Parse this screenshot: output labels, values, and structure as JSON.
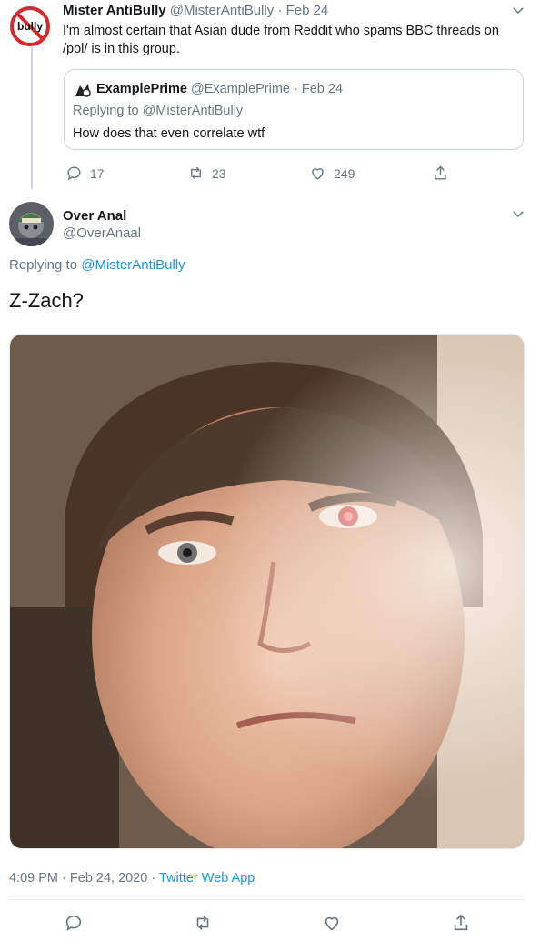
{
  "parent_tweet": {
    "avatar_text": "bully",
    "name": "Mister AntiBully",
    "handle": "@MisterAntiBully",
    "date": "Feb 24",
    "text": "I'm almost certain that Asian dude from Reddit who spams BBC threads on /pol/ is in this group.",
    "quoted": {
      "name": "ExamplePrime",
      "handle": "@ExamplePrime",
      "date": "Feb 24",
      "replying_label": "Replying to",
      "replying_to": "@MisterAntiBully",
      "text": "How does that even correlate wtf"
    },
    "actions": {
      "replies": "17",
      "retweets": "23",
      "likes": "249"
    }
  },
  "main_tweet": {
    "name": "Over Anal",
    "handle": "@OverAnaal",
    "replying_label": "Replying to",
    "replying_to": "@MisterAntiBully",
    "text": "Z-Zach?",
    "time": "4:09 PM",
    "date": "Feb 24, 2020",
    "source": "Twitter Web App"
  },
  "colors": {
    "link": "#1b95e0",
    "muted": "#657786",
    "border": "#ccd6dd",
    "brand_red": "#d4292c"
  },
  "icons": [
    "no-bully-icon",
    "chevron-down-icon",
    "reply-icon",
    "retweet-icon",
    "like-icon",
    "share-icon"
  ]
}
